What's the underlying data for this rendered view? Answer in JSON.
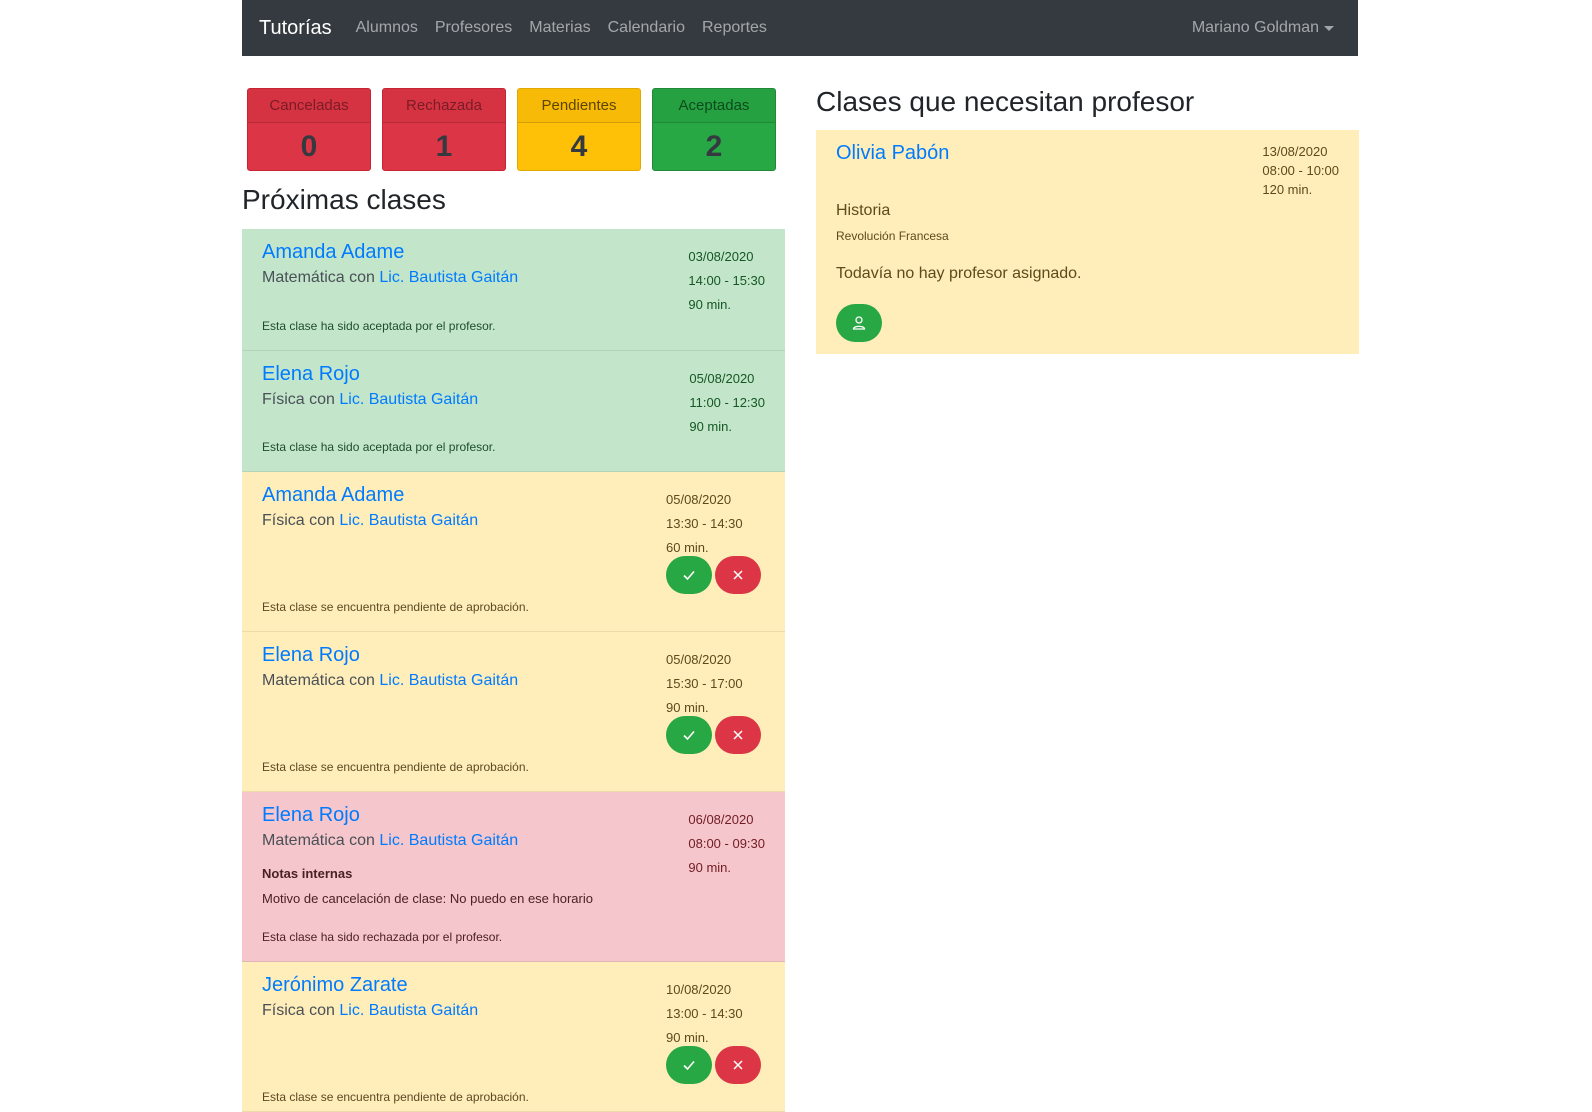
{
  "navbar": {
    "brand": "Tutorías",
    "links": [
      "Alumnos",
      "Profesores",
      "Materias",
      "Calendario",
      "Reportes"
    ],
    "user": "Mariano Goldman"
  },
  "stats": [
    {
      "label": "Canceladas",
      "value": "0",
      "color": "#dc3545"
    },
    {
      "label": "Rechazada",
      "value": "1",
      "color": "#dc3545"
    },
    {
      "label": "Pendientes",
      "value": "4",
      "color": "#ffc107"
    },
    {
      "label": "Aceptadas",
      "value": "2",
      "color": "#28a745"
    }
  ],
  "upcoming": {
    "title": "Próximas clases",
    "items": [
      {
        "student": "Amanda Adame",
        "subject": "Matemática",
        "connector": "con",
        "teacher": "Lic. Bautista Gaitán",
        "date": "03/08/2020",
        "time": "14:00 - 15:30",
        "duration": "90 min.",
        "status": "Esta clase ha sido aceptada por el profesor."
      },
      {
        "student": "Elena Rojo",
        "subject": "Física",
        "connector": "con",
        "teacher": "Lic. Bautista Gaitán",
        "date": "05/08/2020",
        "time": "11:00 - 12:30",
        "duration": "90 min.",
        "status": "Esta clase ha sido aceptada por el profesor."
      },
      {
        "student": "Amanda Adame",
        "subject": "Física",
        "connector": "con",
        "teacher": "Lic. Bautista Gaitán",
        "date": "05/08/2020",
        "time": "13:30 - 14:30",
        "duration": "60 min.",
        "status": "Esta clase se encuentra pendiente de aprobación."
      },
      {
        "student": "Elena Rojo",
        "subject": "Matemática",
        "connector": "con",
        "teacher": "Lic. Bautista Gaitán",
        "date": "05/08/2020",
        "time": "15:30 - 17:00",
        "duration": "90 min.",
        "status": "Esta clase se encuentra pendiente de aprobación."
      },
      {
        "student": "Elena Rojo",
        "subject": "Matemática",
        "connector": "con",
        "teacher": "Lic. Bautista Gaitán",
        "date": "06/08/2020",
        "time": "08:00 - 09:30",
        "duration": "90 min.",
        "notes_title": "Notas internas",
        "notes_text": "Motivo de cancelación de clase: No puedo en ese horario",
        "status": "Esta clase ha sido rechazada por el profesor."
      },
      {
        "student": "Jerónimo Zarate",
        "subject": "Física",
        "connector": "con",
        "teacher": "Lic. Bautista Gaitán",
        "date": "10/08/2020",
        "time": "13:00 - 14:30",
        "duration": "90 min.",
        "status": "Esta clase se encuentra pendiente de aprobación."
      }
    ]
  },
  "needs_teacher": {
    "title": "Clases que necesitan profesor",
    "card": {
      "student": "Olivia Pabón",
      "date": "13/08/2020",
      "time": "08:00 - 10:00",
      "duration": "120 min.",
      "subject": "Historia",
      "topic": "Revolución Francesa",
      "message": "Todavía no hay profesor asignado."
    }
  },
  "icons": {
    "accept": "check-icon",
    "reject": "close-icon",
    "assign": "user-icon"
  }
}
